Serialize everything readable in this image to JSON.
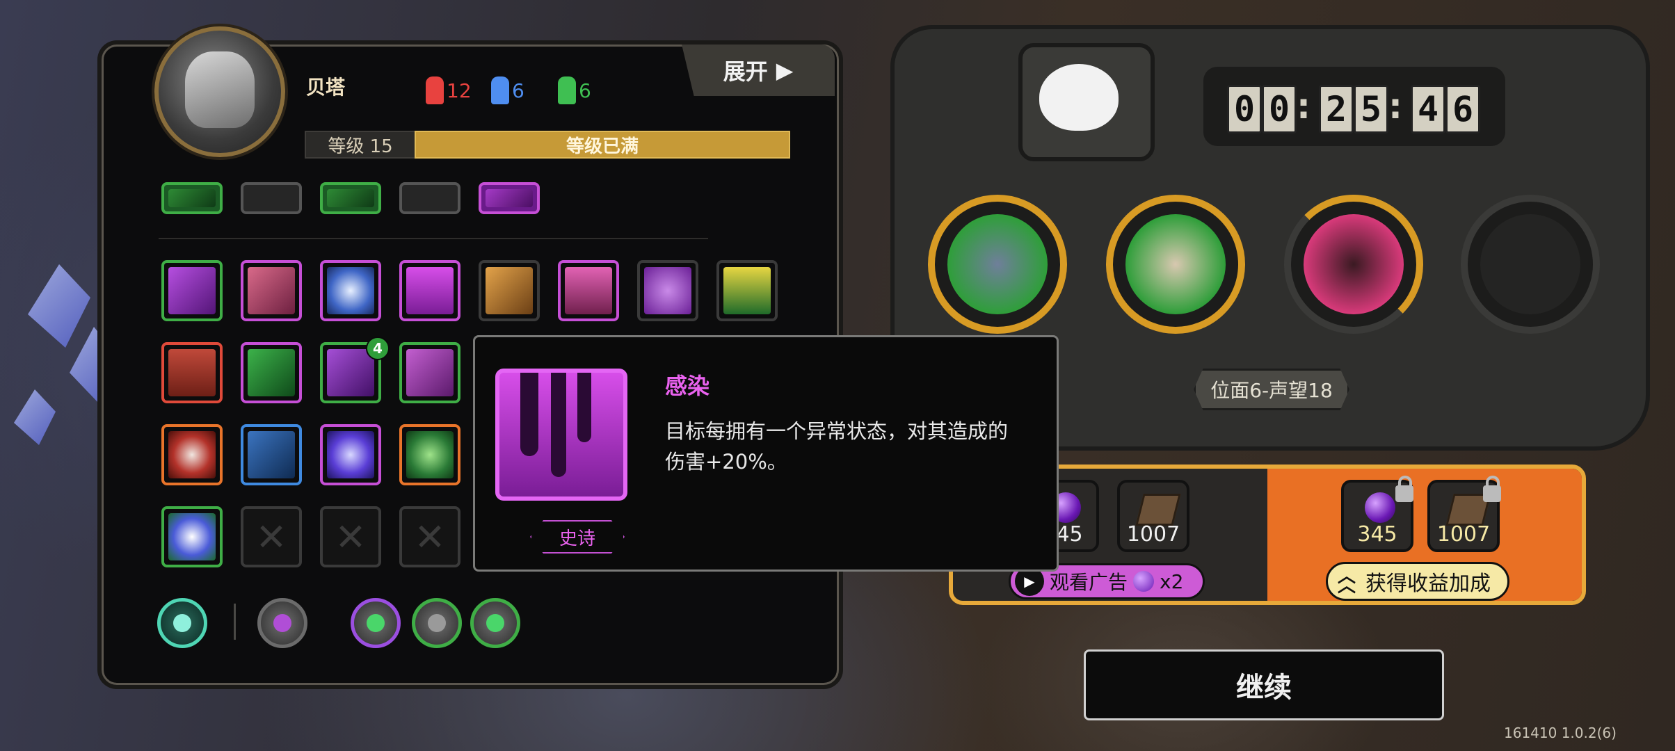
{
  "character": {
    "name": "贝塔",
    "level_label": "等级 15",
    "level_status": "等级已满",
    "expand_label": "展开"
  },
  "resources": [
    {
      "name": "red",
      "value": "12",
      "color": "#e8423f"
    },
    {
      "name": "blue",
      "value": "6",
      "color": "#4f8ef0"
    },
    {
      "name": "green",
      "value": "6",
      "color": "#3fbf52"
    }
  ],
  "skills": {
    "top_row_partial": [
      "green-leaf",
      "gray",
      "green-tree",
      "gray",
      "purple-shield"
    ],
    "grid_badge": "4",
    "empty_slot_symbol": "✕"
  },
  "tooltip": {
    "title": "感染",
    "description": "目标每拥有一个异常状态，对其造成的伤害+20%。",
    "rarity": "史诗"
  },
  "timer": {
    "digits": [
      "0",
      "0",
      "2",
      "5",
      "4",
      "6"
    ]
  },
  "plane_label": "位面6-声望18",
  "rewards": {
    "left": [
      {
        "type": "gem",
        "value": "345"
      },
      {
        "type": "book",
        "value": "1007"
      }
    ],
    "right": [
      {
        "type": "gem",
        "value": "345"
      },
      {
        "type": "book",
        "value": "1007"
      }
    ],
    "ad_button_label": "观看广告",
    "ad_multiplier": "x2",
    "boost_button_label": "获得收益加成"
  },
  "continue_label": "继续",
  "version": "161410 1.0.2(6)",
  "colors": {
    "accent_gold": "#d89b24",
    "epic_purple": "#e962ee",
    "orange_panel": "#e97024"
  }
}
